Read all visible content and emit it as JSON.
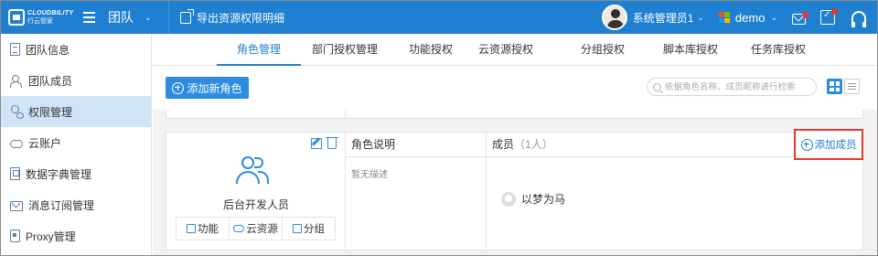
{
  "header": {
    "logo_en": "CLOUDBILITY",
    "logo_cn": "行云管家",
    "team_label": "团队",
    "export_label": "导出资源权限明细",
    "user_name": "系统管理员1",
    "org_name": "demo",
    "brand_color": "#1f7fd1",
    "notification_color": "#e8352e"
  },
  "sidebar": {
    "items": [
      {
        "label": "团队信息",
        "icon": "document-icon",
        "active": false
      },
      {
        "label": "团队成员",
        "icon": "people-icon",
        "active": false
      },
      {
        "label": "权限管理",
        "icon": "key-icon",
        "active": true
      },
      {
        "label": "云账户",
        "icon": "cloud-icon",
        "active": false
      },
      {
        "label": "数据字典管理",
        "icon": "book-icon",
        "active": false
      },
      {
        "label": "消息订阅管理",
        "icon": "envelope-icon",
        "active": false
      },
      {
        "label": "Proxy管理",
        "icon": "proxy-icon",
        "active": false
      }
    ]
  },
  "tabs": [
    {
      "label": "角色管理",
      "active": true
    },
    {
      "label": "部门授权管理",
      "active": false
    },
    {
      "label": "功能授权",
      "active": false
    },
    {
      "label": "云资源授权",
      "active": false
    },
    {
      "label": "分组授权",
      "active": false
    },
    {
      "label": "脚本库授权",
      "active": false
    },
    {
      "label": "任务库授权",
      "active": false
    }
  ],
  "toolbar": {
    "add_role_label": "添加新角色",
    "search_placeholder": "依据角色名称、成员昵称进行检索"
  },
  "role_card": {
    "role_name": "后台开发人员",
    "buttons": [
      "功能",
      "云资源",
      "分组"
    ],
    "desc_header": "角色说明",
    "desc_text": "暂无描述",
    "members_header": "成员",
    "members_count": "（1人）",
    "add_member_label": "添加成员",
    "members": [
      "以梦为马"
    ]
  }
}
